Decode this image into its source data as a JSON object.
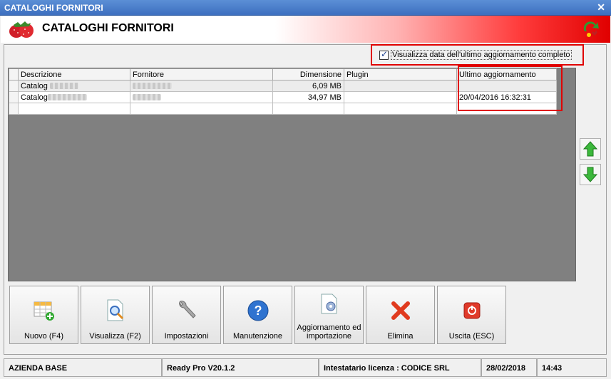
{
  "window": {
    "title": "CATALOGHI FORNITORI"
  },
  "header": {
    "title": "CATALOGHI FORNITORI"
  },
  "options": {
    "show_last_update_label": "Visualizza data dell'ultimo aggiornamento completo",
    "show_last_update_checked": true
  },
  "table": {
    "columns": [
      "Descrizione",
      "Fornitore",
      "Dimensione",
      "Plugin",
      "Ultimo aggiornamento"
    ],
    "rows": [
      {
        "descrizione": "Catalog",
        "fornitore": "",
        "dimensione": "6,09 MB",
        "plugin": "",
        "ultimo": ""
      },
      {
        "descrizione": "Catalog",
        "fornitore": "",
        "dimensione": "34,97 MB",
        "plugin": "",
        "ultimo": "20/04/2016 16:32:31"
      }
    ]
  },
  "buttons": {
    "nuovo": "Nuovo (F4)",
    "visualizza": "Visualizza (F2)",
    "impostazioni": "Impostazioni",
    "manutenzione": "Manutenzione",
    "aggiornamento": "Aggiornamento ed importazione",
    "elimina": "Elimina",
    "uscita": "Uscita (ESC)"
  },
  "status": {
    "azienda": "AZIENDA BASE",
    "version": "Ready Pro V20.1.2",
    "licenza": "Intestatario licenza : CODICE SRL",
    "date": "28/02/2018",
    "time": "14:43"
  },
  "colors": {
    "title_bar": "#3d6fbf",
    "header_red": "#e00000",
    "highlight": "#e00000",
    "grid_bg": "#808080"
  }
}
